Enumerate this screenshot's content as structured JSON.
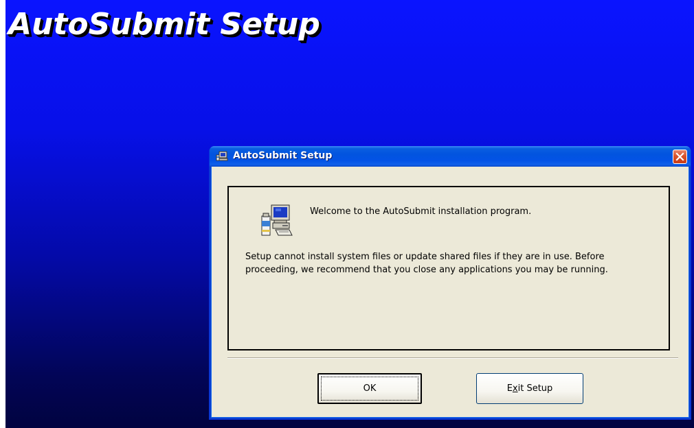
{
  "background": {
    "title": "AutoSubmit Setup",
    "gradient_top": "#0a14ff",
    "gradient_bottom": "#010340"
  },
  "dialog": {
    "title": "AutoSubmit Setup",
    "title_icon": "setup-installer-icon",
    "close_icon": "close-icon",
    "panel_icon": "computer-setup-icon",
    "welcome": "Welcome to the AutoSubmit installation program.",
    "message": "Setup cannot install system files or update shared files if they are in use. Before proceeding, we recommend that you close any applications you may be running.",
    "buttons": {
      "ok": "OK",
      "exit_before": "E",
      "exit_mnemonic": "x",
      "exit_after": "it Setup"
    },
    "colors": {
      "titlebar": "#0254df",
      "face": "#ece9d8",
      "close": "#d9542c"
    }
  }
}
